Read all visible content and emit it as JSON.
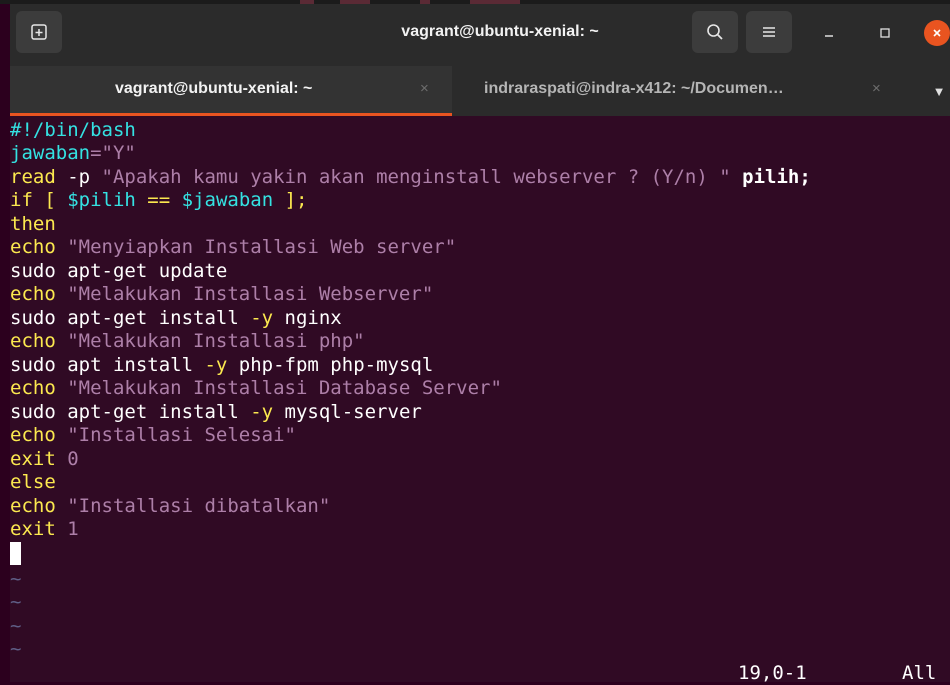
{
  "window": {
    "title": "vagrant@ubuntu-xenial: ~"
  },
  "tabs": [
    {
      "label": "vagrant@ubuntu-xenial: ~",
      "close": "×"
    },
    {
      "label": "indraraspati@indra-x412: ~/Documen…",
      "close": "×"
    }
  ],
  "editor": {
    "lines": {
      "l1": "#!/bin/bash",
      "l2a": "jawaban",
      "l2b": "=\"Y\"",
      "l3a": "read",
      "l3b": " -p ",
      "l3c": "\"Apakah kamu yakin akan menginstall webserver ? (Y/n) \"",
      "l3d": " pilih;",
      "l4a": "if",
      "l4b": " [ ",
      "l4c": "$pilih",
      "l4d": " == ",
      "l4e": "$jawaban",
      "l4f": " ];",
      "l5": "then",
      "l6a": "echo",
      "l6b": " \"Menyiapkan Installasi Web server\"",
      "l7": "sudo apt-get update",
      "l8a": "echo",
      "l8b": " \"Melakukan Installasi Webserver\"",
      "l9a": "sudo apt-get install ",
      "l9b": "-y",
      "l9c": " nginx",
      "l10a": "echo",
      "l10b": " \"Melakukan Installasi php\"",
      "l11a": "sudo apt install ",
      "l11b": "-y",
      "l11c": " php-fpm php-mysql",
      "l12a": "echo",
      "l12b": " \"Melakukan Installasi Database Server\"",
      "l13a": "sudo apt-get install ",
      "l13b": "-y",
      "l13c": " mysql-server",
      "l14a": "echo",
      "l14b": " \"Installasi Selesai\"",
      "l15a": "exit",
      "l15b": " 0",
      "l16": "else",
      "l17a": "echo",
      "l17b": " \"Installasi dibatalkan\"",
      "l18a": "exit",
      "l18b": " 1"
    },
    "tilde": "~",
    "position": "19,0-1",
    "scroll": "All"
  },
  "colors": {
    "background": "#300a24",
    "accent": "#e95420",
    "keyword": "#fce94f",
    "variable": "#34e2e2",
    "string": "#ad7fa8"
  },
  "icons": [
    "new-tab-icon",
    "search-icon",
    "hamburger-menu-icon",
    "minimize-icon",
    "maximize-icon",
    "close-icon",
    "chevron-down-icon"
  ]
}
